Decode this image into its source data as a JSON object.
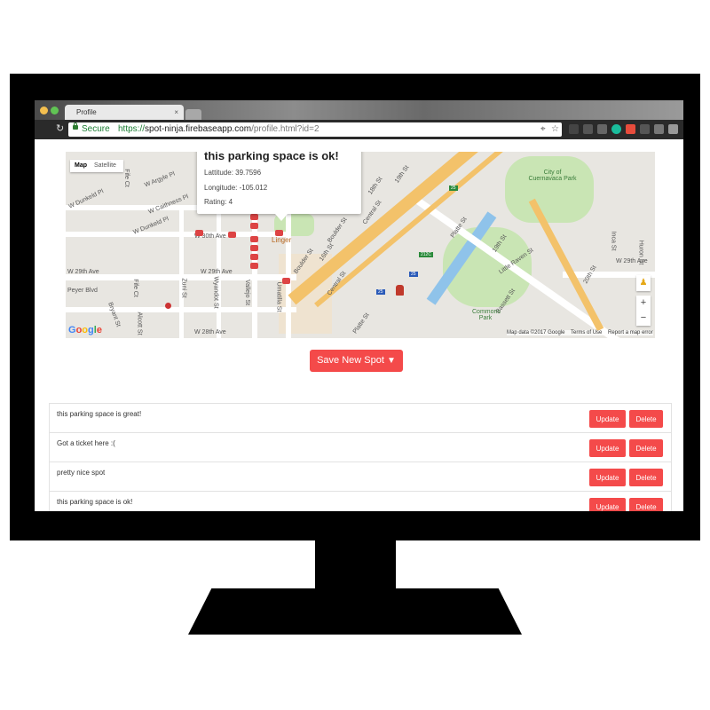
{
  "browser": {
    "tab_title": "Profile",
    "tab_close": "×",
    "secure_label": "Secure",
    "url_scheme": "https://",
    "url_host": "spot-ninja.firebaseapp.com",
    "url_path": "/profile.html?id=2"
  },
  "map": {
    "type_buttons": [
      "Map",
      "Satellite"
    ],
    "info_window": {
      "title": "this parking space is ok!",
      "latitude": "Lattitude: 39.7596",
      "longitude": "Longitude: -105.012",
      "rating": "Rating: 4"
    },
    "labels": {
      "w_argyle": "W Argyle Pl",
      "w_caithness": "W Caithness Pl",
      "w_dunkeld_1": "W Dunkeld Pl",
      "w_dunkeld_2": "W Dunkeld Pl",
      "w_30th": "W 30th Ave",
      "w_29th": "W 29th Ave",
      "w_29th_2": "W 29th Ave",
      "w_29th_3": "W 29th Ave",
      "w_28th": "W 28th Ave",
      "fife": "Fife Ct",
      "fife_2": "Fife Ct",
      "zuni": "Zuni St",
      "wyandot": "Wyandot St",
      "vallejo": "Vallejo St",
      "umatilla": "Umatilla St",
      "boulder": "Boulder St",
      "boulder_2": "Boulder St",
      "sixteenth": "16th St",
      "eighteenth": "18th St",
      "nineteenth": "19th St",
      "central": "Central St",
      "central_2": "Central St",
      "platte": "Platte St",
      "platte_2": "Platte St",
      "nineteenth_2": "19th St",
      "little_raven": "Little Raven St",
      "bassett": "Bassett St",
      "twentieth": "20th St",
      "inca": "Inca St",
      "huron": "Huron St",
      "city_park": "City of Cuernavaca Park",
      "commons_park": "Commons Park",
      "linger": "Linger",
      "shield_25": "25",
      "shield_25b": "25",
      "shield_25c": "25",
      "shield_212c": "212C",
      "bryant": "Bryant St",
      "alcott": "Alcott St",
      "peyer": "Peyer Blvd"
    },
    "zoom_in": "+",
    "zoom_out": "−",
    "google_logo": "Google",
    "attribution": [
      "Map data ©2017 Google",
      "Terms of Use",
      "Report a map error"
    ]
  },
  "save_button": {
    "label": "Save New Spot",
    "icon": "map-pin-icon"
  },
  "spots": [
    {
      "text": "this parking space is great!",
      "update": "Update",
      "delete": "Delete"
    },
    {
      "text": "Got a ticket here :(",
      "update": "Update",
      "delete": "Delete"
    },
    {
      "text": "pretty nice spot",
      "update": "Update",
      "delete": "Delete"
    },
    {
      "text": "this parking space is ok!",
      "update": "Update",
      "delete": "Delete"
    }
  ],
  "colors": {
    "accent": "#f44a4a",
    "secure_green": "#1b7d33"
  }
}
